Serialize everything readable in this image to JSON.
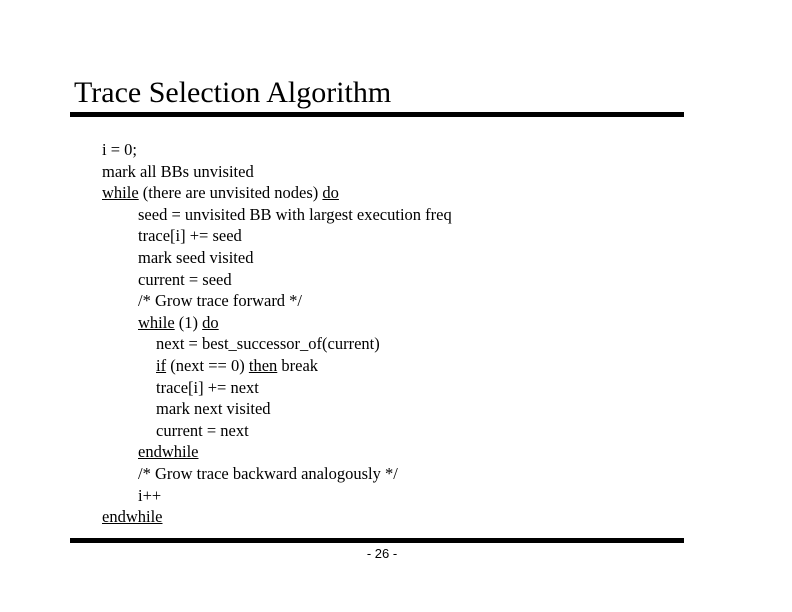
{
  "slide": {
    "title": "Trace Selection Algorithm",
    "page_number": "- 26 -",
    "lines": [
      {
        "indent": 0,
        "parts": [
          {
            "t": "i = 0;",
            "kw": false
          }
        ]
      },
      {
        "indent": 0,
        "parts": [
          {
            "t": "mark all BBs unvisited",
            "kw": false
          }
        ]
      },
      {
        "indent": 0,
        "parts": [
          {
            "t": "while",
            "kw": true
          },
          {
            "t": " (there are unvisited nodes) ",
            "kw": false
          },
          {
            "t": "do",
            "kw": true
          }
        ]
      },
      {
        "indent": 1,
        "parts": [
          {
            "t": "seed = unvisited BB with largest execution freq",
            "kw": false
          }
        ]
      },
      {
        "indent": 1,
        "parts": [
          {
            "t": "trace[i] += seed",
            "kw": false
          }
        ]
      },
      {
        "indent": 1,
        "parts": [
          {
            "t": "mark seed visited",
            "kw": false
          }
        ]
      },
      {
        "indent": 1,
        "parts": [
          {
            "t": "current = seed",
            "kw": false
          }
        ]
      },
      {
        "indent": 1,
        "parts": [
          {
            "t": "/* Grow trace forward */",
            "kw": false
          }
        ]
      },
      {
        "indent": 1,
        "parts": [
          {
            "t": "while",
            "kw": true
          },
          {
            "t": " (1) ",
            "kw": false
          },
          {
            "t": "do",
            "kw": true
          }
        ]
      },
      {
        "indent": 2,
        "parts": [
          {
            "t": "next = best_successor_of(current)",
            "kw": false
          }
        ]
      },
      {
        "indent": 2,
        "parts": [
          {
            "t": "if",
            "kw": true
          },
          {
            "t": " (next == 0) ",
            "kw": false
          },
          {
            "t": "then",
            "kw": true
          },
          {
            "t": " break",
            "kw": false
          }
        ]
      },
      {
        "indent": 2,
        "parts": [
          {
            "t": "trace[i] += next",
            "kw": false
          }
        ]
      },
      {
        "indent": 2,
        "parts": [
          {
            "t": "mark next visited",
            "kw": false
          }
        ]
      },
      {
        "indent": 2,
        "parts": [
          {
            "t": "current = next",
            "kw": false
          }
        ]
      },
      {
        "indent": 1,
        "parts": [
          {
            "t": "endwhile",
            "kw": true
          }
        ]
      },
      {
        "indent": 1,
        "parts": [
          {
            "t": "/* Grow trace backward analogously */",
            "kw": false
          }
        ]
      },
      {
        "indent": 1,
        "parts": [
          {
            "t": "i++",
            "kw": false
          }
        ]
      },
      {
        "indent": 0,
        "parts": [
          {
            "t": "endwhile",
            "kw": true
          }
        ]
      }
    ]
  }
}
